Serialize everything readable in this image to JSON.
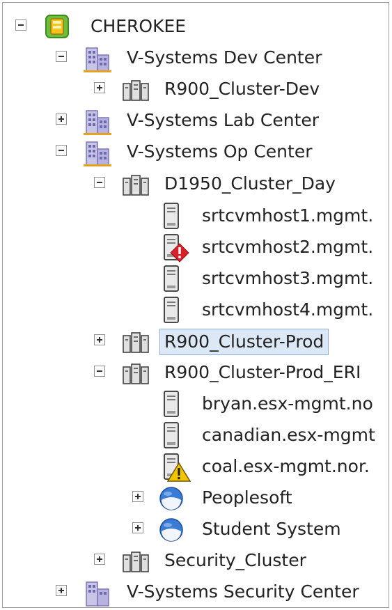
{
  "tree": {
    "root": "CHEROKEE",
    "dev_center": "V-Systems Dev Center",
    "cluster_dev": "R900_Cluster-Dev",
    "lab_center": "V-Systems Lab Center",
    "op_center": "V-Systems Op Center",
    "cluster_day": "D1950_Cluster_Day",
    "host1": "srtcvmhost1.mgmt.",
    "host2": "srtcvmhost2.mgmt.",
    "host3": "srtcvmhost3.mgmt.",
    "host4": "srtcvmhost4.mgmt.",
    "cluster_prod": "R900_Cluster-Prod",
    "cluster_prod_erp": "R900_Cluster-Prod_ERI",
    "host_bryan": "bryan.esx-mgmt.no",
    "host_canadian": "canadian.esx-mgmt",
    "host_coal": "coal.esx-mgmt.nor.",
    "pool_peoplesoft": "Peoplesoft",
    "pool_student": "Student System",
    "cluster_security": "Security_Cluster",
    "security_center": "V-Systems Security Center"
  },
  "colors": {
    "selected_bg": "#dde8f6",
    "selected_border": "#8fb0d8",
    "error": "#d8202b",
    "warning": "#f2c400"
  }
}
